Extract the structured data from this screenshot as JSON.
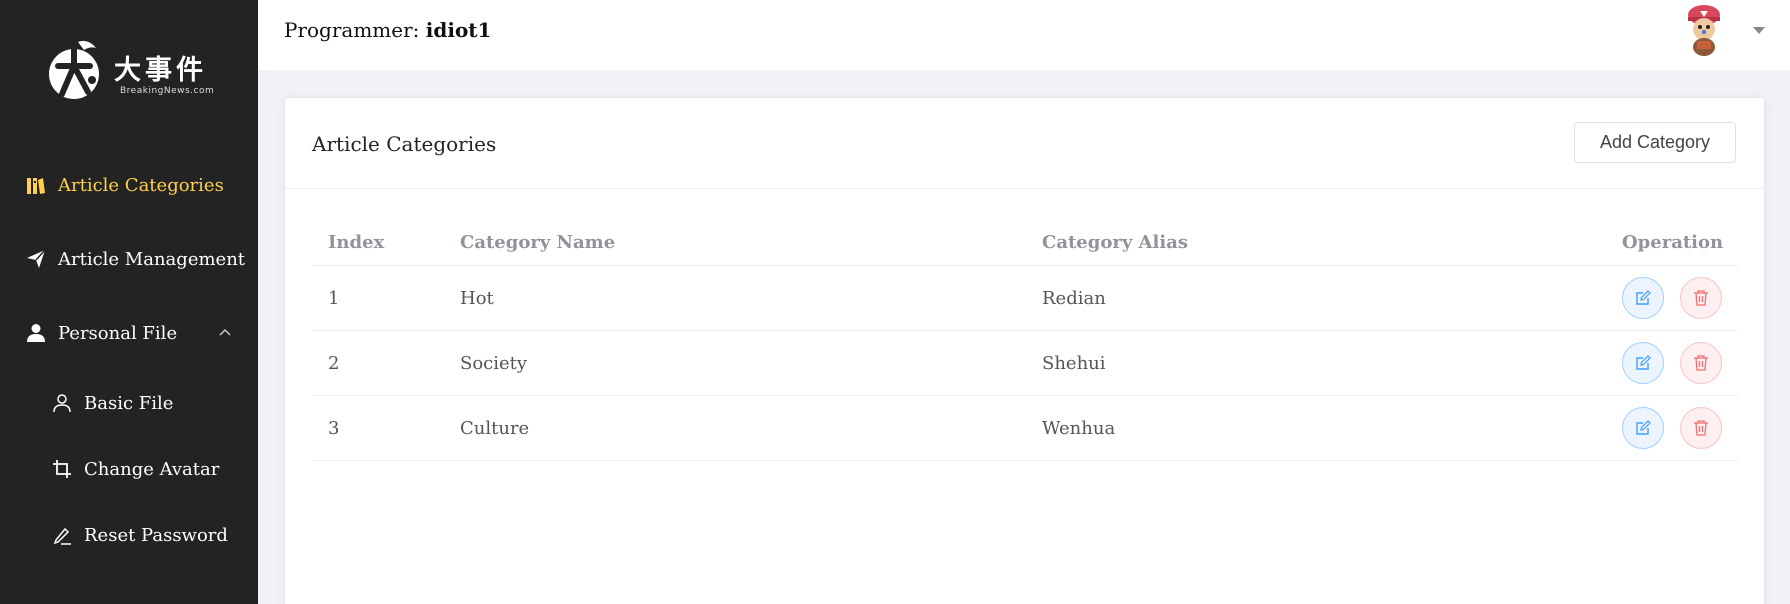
{
  "sidebar": {
    "logo": {
      "cn": "大事件",
      "en": "BreakingNews.com"
    },
    "items": [
      {
        "label": "Article Categories",
        "icon": "book-icon",
        "active": true
      },
      {
        "label": "Article Management",
        "icon": "paper-plane-icon"
      },
      {
        "label": "Personal File",
        "icon": "user-icon",
        "expanded": true
      }
    ],
    "subitems": [
      {
        "label": "Basic File",
        "icon": "user-outline-icon"
      },
      {
        "label": "Change Avatar",
        "icon": "crop-icon"
      },
      {
        "label": "Reset Password",
        "icon": "edit-pen-icon"
      }
    ]
  },
  "header": {
    "prefix": "Programmer: ",
    "username": "idiot1"
  },
  "card": {
    "title": "Article Categories",
    "add_button": "Add Category"
  },
  "table": {
    "columns": [
      "Index",
      "Category Name",
      "Category Alias",
      "Operation"
    ],
    "rows": [
      {
        "index": "1",
        "name": "Hot",
        "alias": "Redian"
      },
      {
        "index": "2",
        "name": "Society",
        "alias": "Shehui"
      },
      {
        "index": "3",
        "name": "Culture",
        "alias": "Wenhua"
      }
    ]
  },
  "colors": {
    "sidebar_bg": "#232323",
    "active": "#ffd04b",
    "primary": "#409eff",
    "danger": "#f56c6c"
  }
}
